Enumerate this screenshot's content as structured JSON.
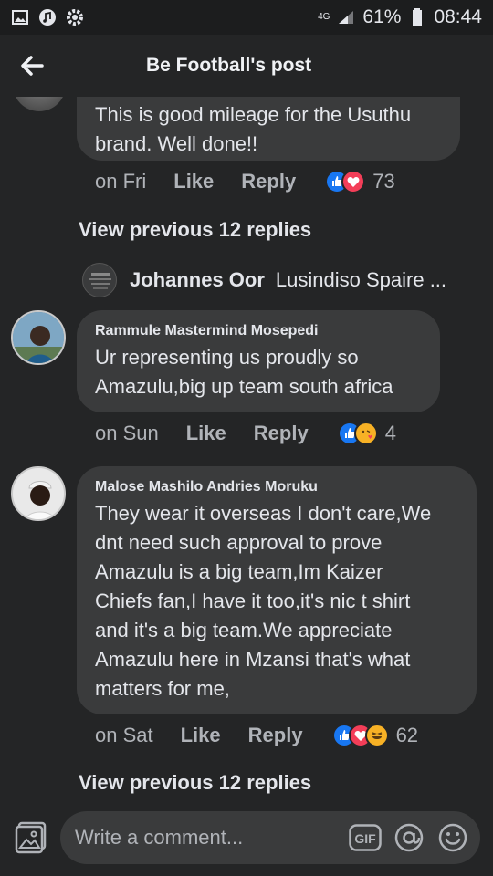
{
  "status_bar": {
    "network": "4G",
    "battery": "61%",
    "time": "08:44"
  },
  "header": {
    "title": "Be Football's post"
  },
  "comments": [
    {
      "text": "This is good mileage for the Usuthu brand. Well done!!",
      "lines": [
        "This is good mileage for the Usuthu",
        "brand. Well done!!"
      ],
      "time": "on Fri",
      "like": "Like",
      "reply": "Reply",
      "reaction_count": "73"
    }
  ],
  "view_previous_1": "View previous 12 replies",
  "reply_preview": {
    "name": "Johannes Oor",
    "snippet": "Lusindiso Spaire ..."
  },
  "comment_rammule": {
    "author": "Rammule Mastermind Mosepedi",
    "lines": [
      "Ur representing us proudly so",
      "Amazulu,big up team south africa"
    ],
    "time": "on Sun",
    "like": "Like",
    "reply": "Reply",
    "reaction_count": "4"
  },
  "comment_malose": {
    "author": "Malose Mashilo Andries Moruku",
    "lines": [
      "They wear it overseas I don't care,We",
      "dnt need such approval to prove",
      "Amazulu is a  big team,Im Kaizer",
      "Chiefs fan,I have it too,it's nic t shirt",
      "and it's a big team.We appreciate",
      "Amazulu here in Mzansi that's what",
      "matters for me,"
    ],
    "time": "on Sat",
    "like": "Like",
    "reply": "Reply",
    "reaction_count": "62"
  },
  "view_previous_2": "View previous 12 replies",
  "composer": {
    "placeholder": "Write a comment...",
    "gif_label": "GIF"
  },
  "colors": {
    "background": "#242526",
    "bubble": "#3a3b3c",
    "like_blue": "#1877f2",
    "love_red": "#f33e58"
  }
}
